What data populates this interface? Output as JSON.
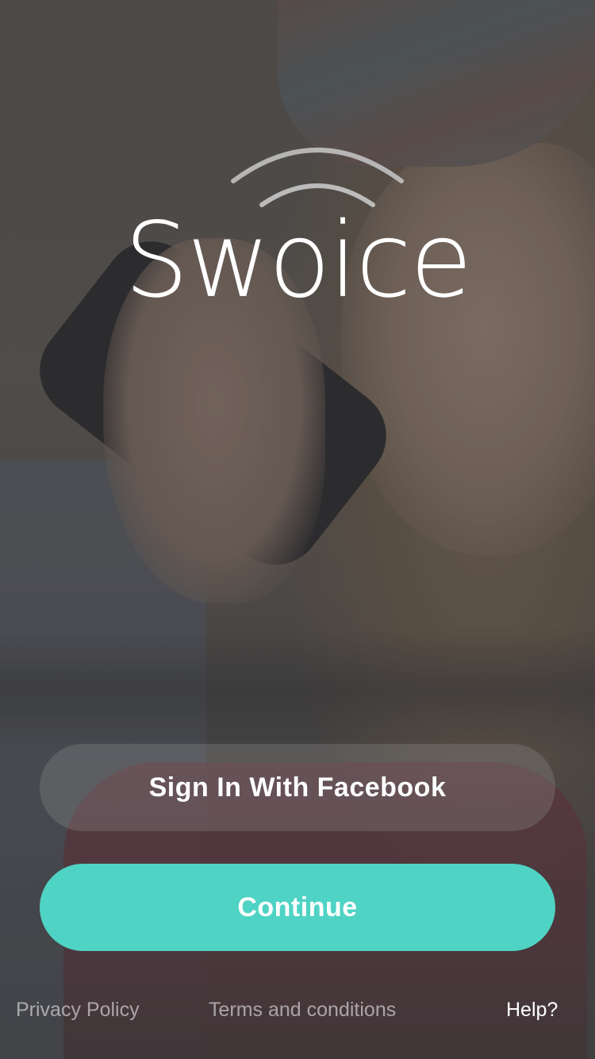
{
  "app": {
    "logo_text": "Swoice"
  },
  "buttons": {
    "facebook_label": "Sign In With Facebook",
    "continue_label": "Continue"
  },
  "footer": {
    "privacy_label": "Privacy Policy",
    "terms_label": "Terms and conditions",
    "help_label": "Help?"
  },
  "colors": {
    "accent": "#4fd3c4",
    "facebook_button_bg": "rgba(150,150,150,0.28)",
    "logo_arc": "#c8c8c8"
  },
  "icons": {
    "logo_mark": "signal-arcs-icon"
  }
}
